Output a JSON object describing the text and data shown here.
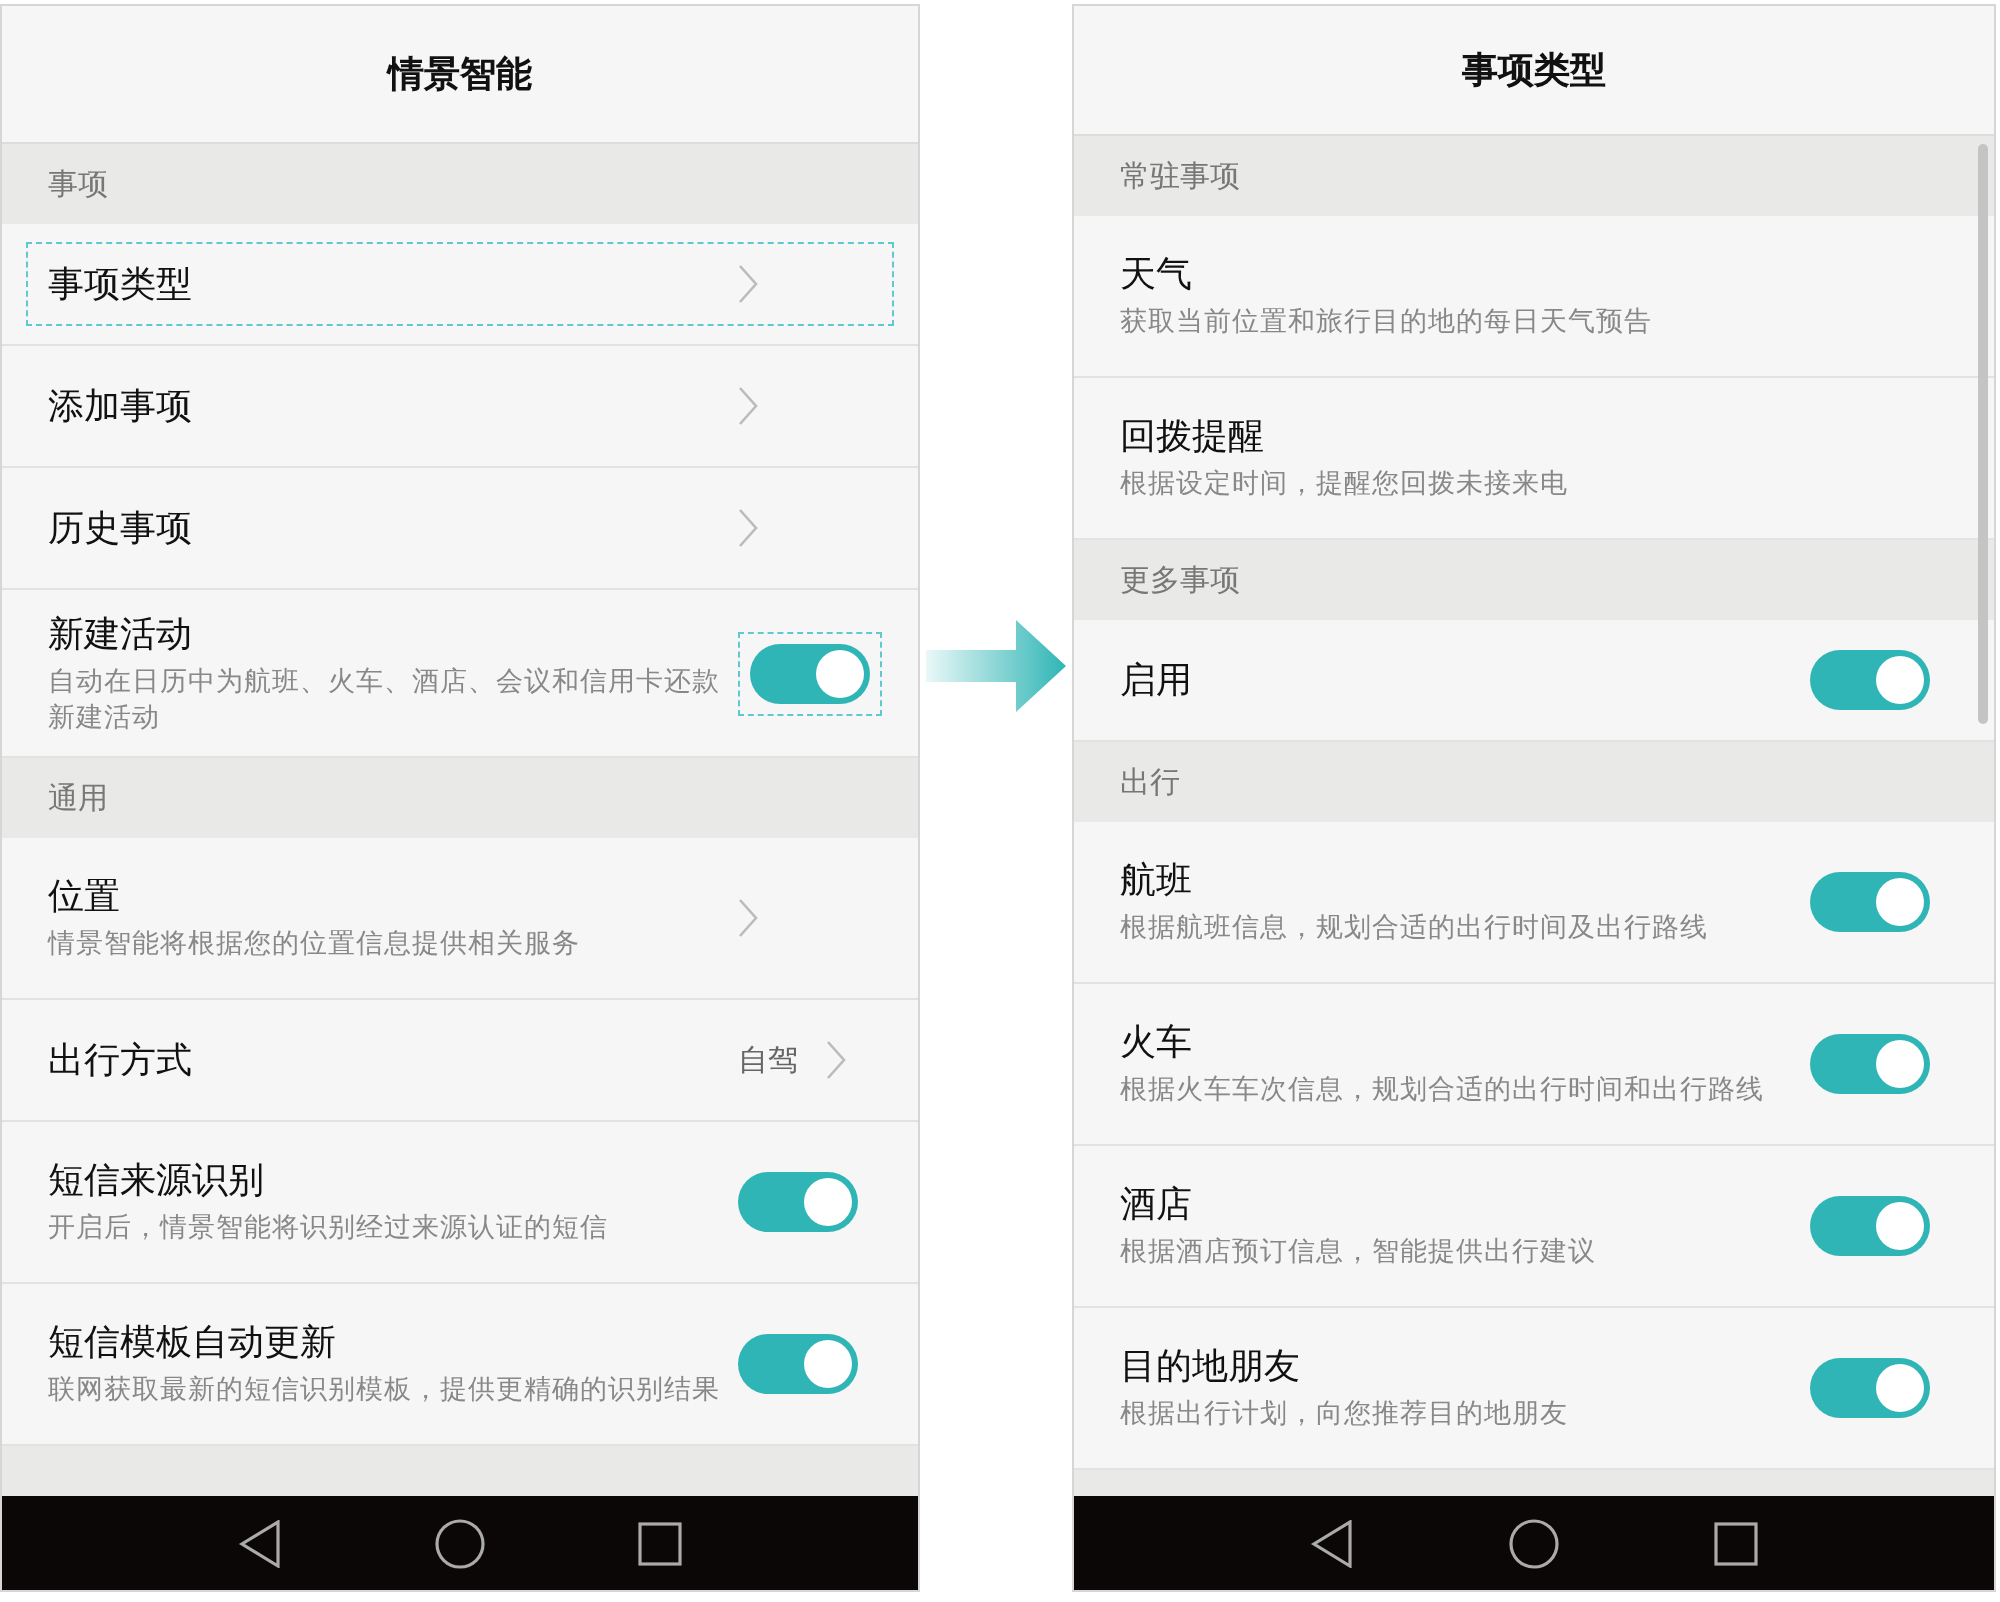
{
  "screens": [
    {
      "title": "情景智能",
      "sections": [
        {
          "header": "事项",
          "items": [
            {
              "kind": "link",
              "title": "事项类型",
              "highlighted": true
            },
            {
              "kind": "link",
              "title": "添加事项",
              "highlighted": false
            },
            {
              "kind": "link",
              "title": "历史事项",
              "highlighted": false
            },
            {
              "kind": "toggle",
              "title": "新建活动",
              "subtitle": "自动在日历中为航班、火车、酒店、会议和信用卡还款新建活动",
              "on": true,
              "highlighted": true
            }
          ]
        },
        {
          "header": "通用",
          "items": [
            {
              "kind": "link",
              "title": "位置",
              "subtitle": "情景智能将根据您的位置信息提供相关服务",
              "highlighted": false
            },
            {
              "kind": "link",
              "title": "出行方式",
              "value": "自驾",
              "highlighted": false
            },
            {
              "kind": "toggle",
              "title": "短信来源识别",
              "subtitle": "开启后，情景智能将识别经过来源认证的短信",
              "on": true,
              "highlighted": false
            },
            {
              "kind": "toggle",
              "title": "短信模板自动更新",
              "subtitle": "联网获取最新的短信识别模板，提供更精确的识别结果",
              "on": true,
              "highlighted": false
            }
          ]
        }
      ]
    },
    {
      "title": "事项类型",
      "scrollbar": true,
      "sections": [
        {
          "header": "常驻事项",
          "items": [
            {
              "kind": "plain",
              "title": "天气",
              "subtitle": "获取当前位置和旅行目的地的每日天气预告",
              "highlighted": false
            },
            {
              "kind": "plain",
              "title": "回拨提醒",
              "subtitle": "根据设定时间，提醒您回拨未接来电",
              "highlighted": false
            }
          ]
        },
        {
          "header": "更多事项",
          "items": [
            {
              "kind": "toggle",
              "title": "启用",
              "on": true,
              "highlighted": false
            }
          ]
        },
        {
          "header": "出行",
          "items": [
            {
              "kind": "toggle",
              "title": "航班",
              "subtitle": "根据航班信息，规划合适的出行时间及出行路线",
              "on": true,
              "highlighted": false
            },
            {
              "kind": "toggle",
              "title": "火车",
              "subtitle": "根据火车车次信息，规划合适的出行时间和出行路线",
              "on": true,
              "highlighted": false
            },
            {
              "kind": "toggle",
              "title": "酒店",
              "subtitle": "根据酒店预订信息，智能提供出行建议",
              "on": true,
              "highlighted": false
            },
            {
              "kind": "toggle",
              "title": "目的地朋友",
              "subtitle": "根据出行计划，向您推荐目的地朋友",
              "on": true,
              "highlighted": false
            }
          ]
        }
      ]
    }
  ]
}
